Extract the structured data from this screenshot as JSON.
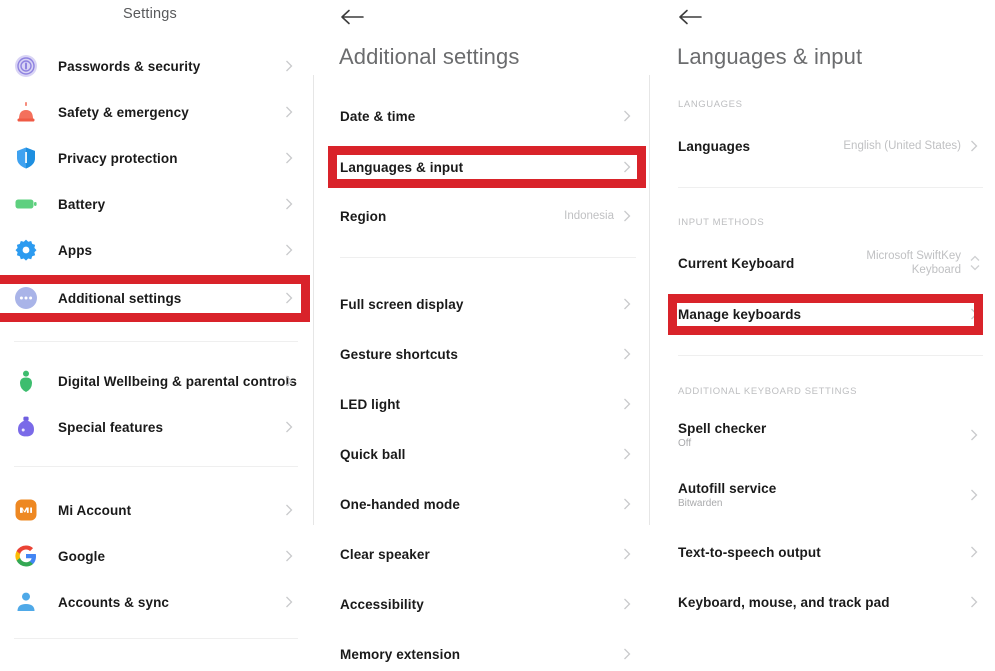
{
  "panel_settings": {
    "title": "Settings",
    "items": [
      {
        "label": "Passwords & security",
        "icon": "fingerprint-icon"
      },
      {
        "label": "Safety & emergency",
        "icon": "siren-icon"
      },
      {
        "label": "Privacy protection",
        "icon": "shield-icon"
      },
      {
        "label": "Battery",
        "icon": "battery-icon"
      },
      {
        "label": "Apps",
        "icon": "gear-icon"
      },
      {
        "label": "Additional settings",
        "icon": "more-dots-icon"
      },
      {
        "label": "Digital Wellbeing & parental controls",
        "icon": "wellbeing-icon"
      },
      {
        "label": "Special features",
        "icon": "special-features-icon"
      },
      {
        "label": "Mi Account",
        "icon": "mi-account-icon"
      },
      {
        "label": "Google",
        "icon": "google-icon"
      },
      {
        "label": "Accounts & sync",
        "icon": "person-icon"
      }
    ]
  },
  "panel_additional": {
    "title": "Additional settings",
    "back": "back-arrow",
    "items": [
      {
        "label": "Date & time",
        "value": ""
      },
      {
        "label": "Languages & input",
        "value": ""
      },
      {
        "label": "Region",
        "value": "Indonesia"
      },
      {
        "label": "Full screen display",
        "value": ""
      },
      {
        "label": "Gesture shortcuts",
        "value": ""
      },
      {
        "label": "LED light",
        "value": ""
      },
      {
        "label": "Quick ball",
        "value": ""
      },
      {
        "label": "One-handed mode",
        "value": ""
      },
      {
        "label": "Clear speaker",
        "value": ""
      },
      {
        "label": "Accessibility",
        "value": ""
      },
      {
        "label": "Memory extension",
        "value": ""
      }
    ]
  },
  "panel_languages": {
    "title": "Languages & input",
    "back": "back-arrow",
    "sections": [
      {
        "header": "LANGUAGES"
      },
      {
        "header": "INPUT METHODS"
      },
      {
        "header": "ADDITIONAL KEYBOARD SETTINGS"
      }
    ],
    "items": [
      {
        "label": "Languages",
        "value": "English (United States)",
        "sub": ""
      },
      {
        "label": "Current Keyboard",
        "value": "Microsoft SwiftKey\nKeyboard",
        "sub": ""
      },
      {
        "label": "Manage keyboards",
        "value": "",
        "sub": ""
      },
      {
        "label": "Spell checker",
        "value": "",
        "sub": "Off"
      },
      {
        "label": "Autofill service",
        "value": "",
        "sub": "Bitwarden"
      },
      {
        "label": "Text-to-speech output",
        "value": "",
        "sub": ""
      },
      {
        "label": "Keyboard, mouse, and track pad",
        "value": "",
        "sub": ""
      }
    ]
  },
  "annotations": {
    "highlight_color": "#d9232a",
    "boxes": [
      {
        "target": "Additional settings"
      },
      {
        "target": "Languages & input"
      },
      {
        "target": "Manage keyboards"
      }
    ]
  }
}
